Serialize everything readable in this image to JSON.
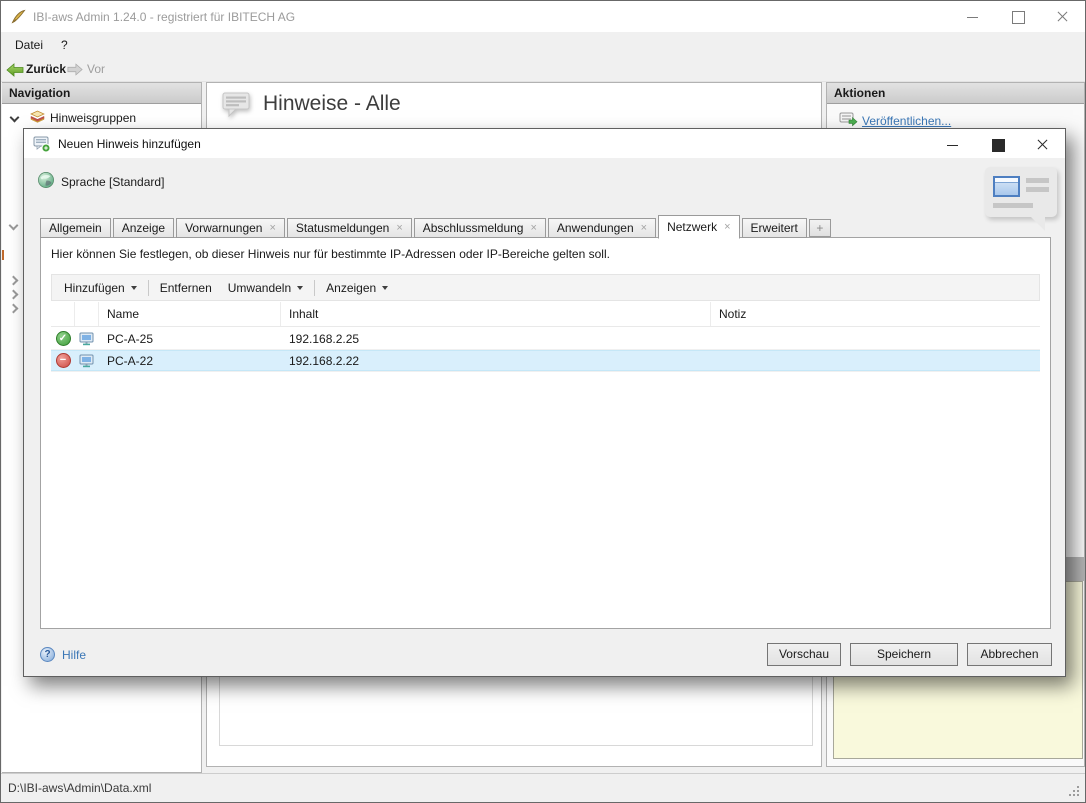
{
  "window": {
    "title": "IBI-aws Admin 1.24.0 - registriert für IBITECH AG"
  },
  "icons": {
    "tab_close": "×",
    "plus_tab": "+",
    "check": "✓",
    "deny": "−",
    "help": "?"
  },
  "menu": {
    "items": [
      "Datei",
      "?"
    ]
  },
  "toolbar": {
    "back": "Zurück",
    "forward": "Vor"
  },
  "navigation": {
    "header": "Navigation",
    "root_item": "Hinweisgruppen"
  },
  "main": {
    "title": "Hinweise - Alle"
  },
  "actions": {
    "header": "Aktionen",
    "publish": "Veröffentlichen..."
  },
  "statusbar": {
    "path": "D:\\IBI-aws\\Admin\\Data.xml"
  },
  "dialog": {
    "title": "Neuen Hinweis hinzufügen",
    "language": "Sprache [Standard]",
    "tabs": [
      {
        "label": "Allgemein",
        "closable": false,
        "active": false
      },
      {
        "label": "Anzeige",
        "closable": false,
        "active": false
      },
      {
        "label": "Vorwarnungen",
        "closable": true,
        "active": false
      },
      {
        "label": "Statusmeldungen",
        "closable": true,
        "active": false
      },
      {
        "label": "Abschlussmeldung",
        "closable": true,
        "active": false
      },
      {
        "label": "Anwendungen",
        "closable": true,
        "active": false
      },
      {
        "label": "Netzwerk",
        "closable": true,
        "active": true
      },
      {
        "label": "Erweitert",
        "closable": false,
        "active": false
      }
    ],
    "info_text": "Hier können Sie festlegen, ob dieser Hinweis nur für bestimmte IP-Adressen oder IP-Bereiche gelten soll.",
    "toolbar": {
      "add": "Hinzufügen",
      "remove": "Entfernen",
      "convert": "Umwandeln",
      "show": "Anzeigen"
    },
    "table": {
      "columns": [
        "Name",
        "Inhalt",
        "Notiz"
      ],
      "rows": [
        {
          "status": "allowed",
          "name": "PC-A-25",
          "inhalt": "192.168.2.25",
          "notiz": "",
          "selected": false
        },
        {
          "status": "denied",
          "name": "PC-A-22",
          "inhalt": "192.168.2.22",
          "notiz": "",
          "selected": true
        }
      ]
    },
    "footer": {
      "help": "Hilfe",
      "preview": "Vorschau",
      "save": "Speichern",
      "cancel": "Abbrechen"
    }
  },
  "colors": {
    "selection": "#d9effc",
    "link": "#3b77b6",
    "note_bg": "#f9f9dc",
    "allowed_green": "#3f9e3a",
    "denied_red": "#cd4a42"
  }
}
